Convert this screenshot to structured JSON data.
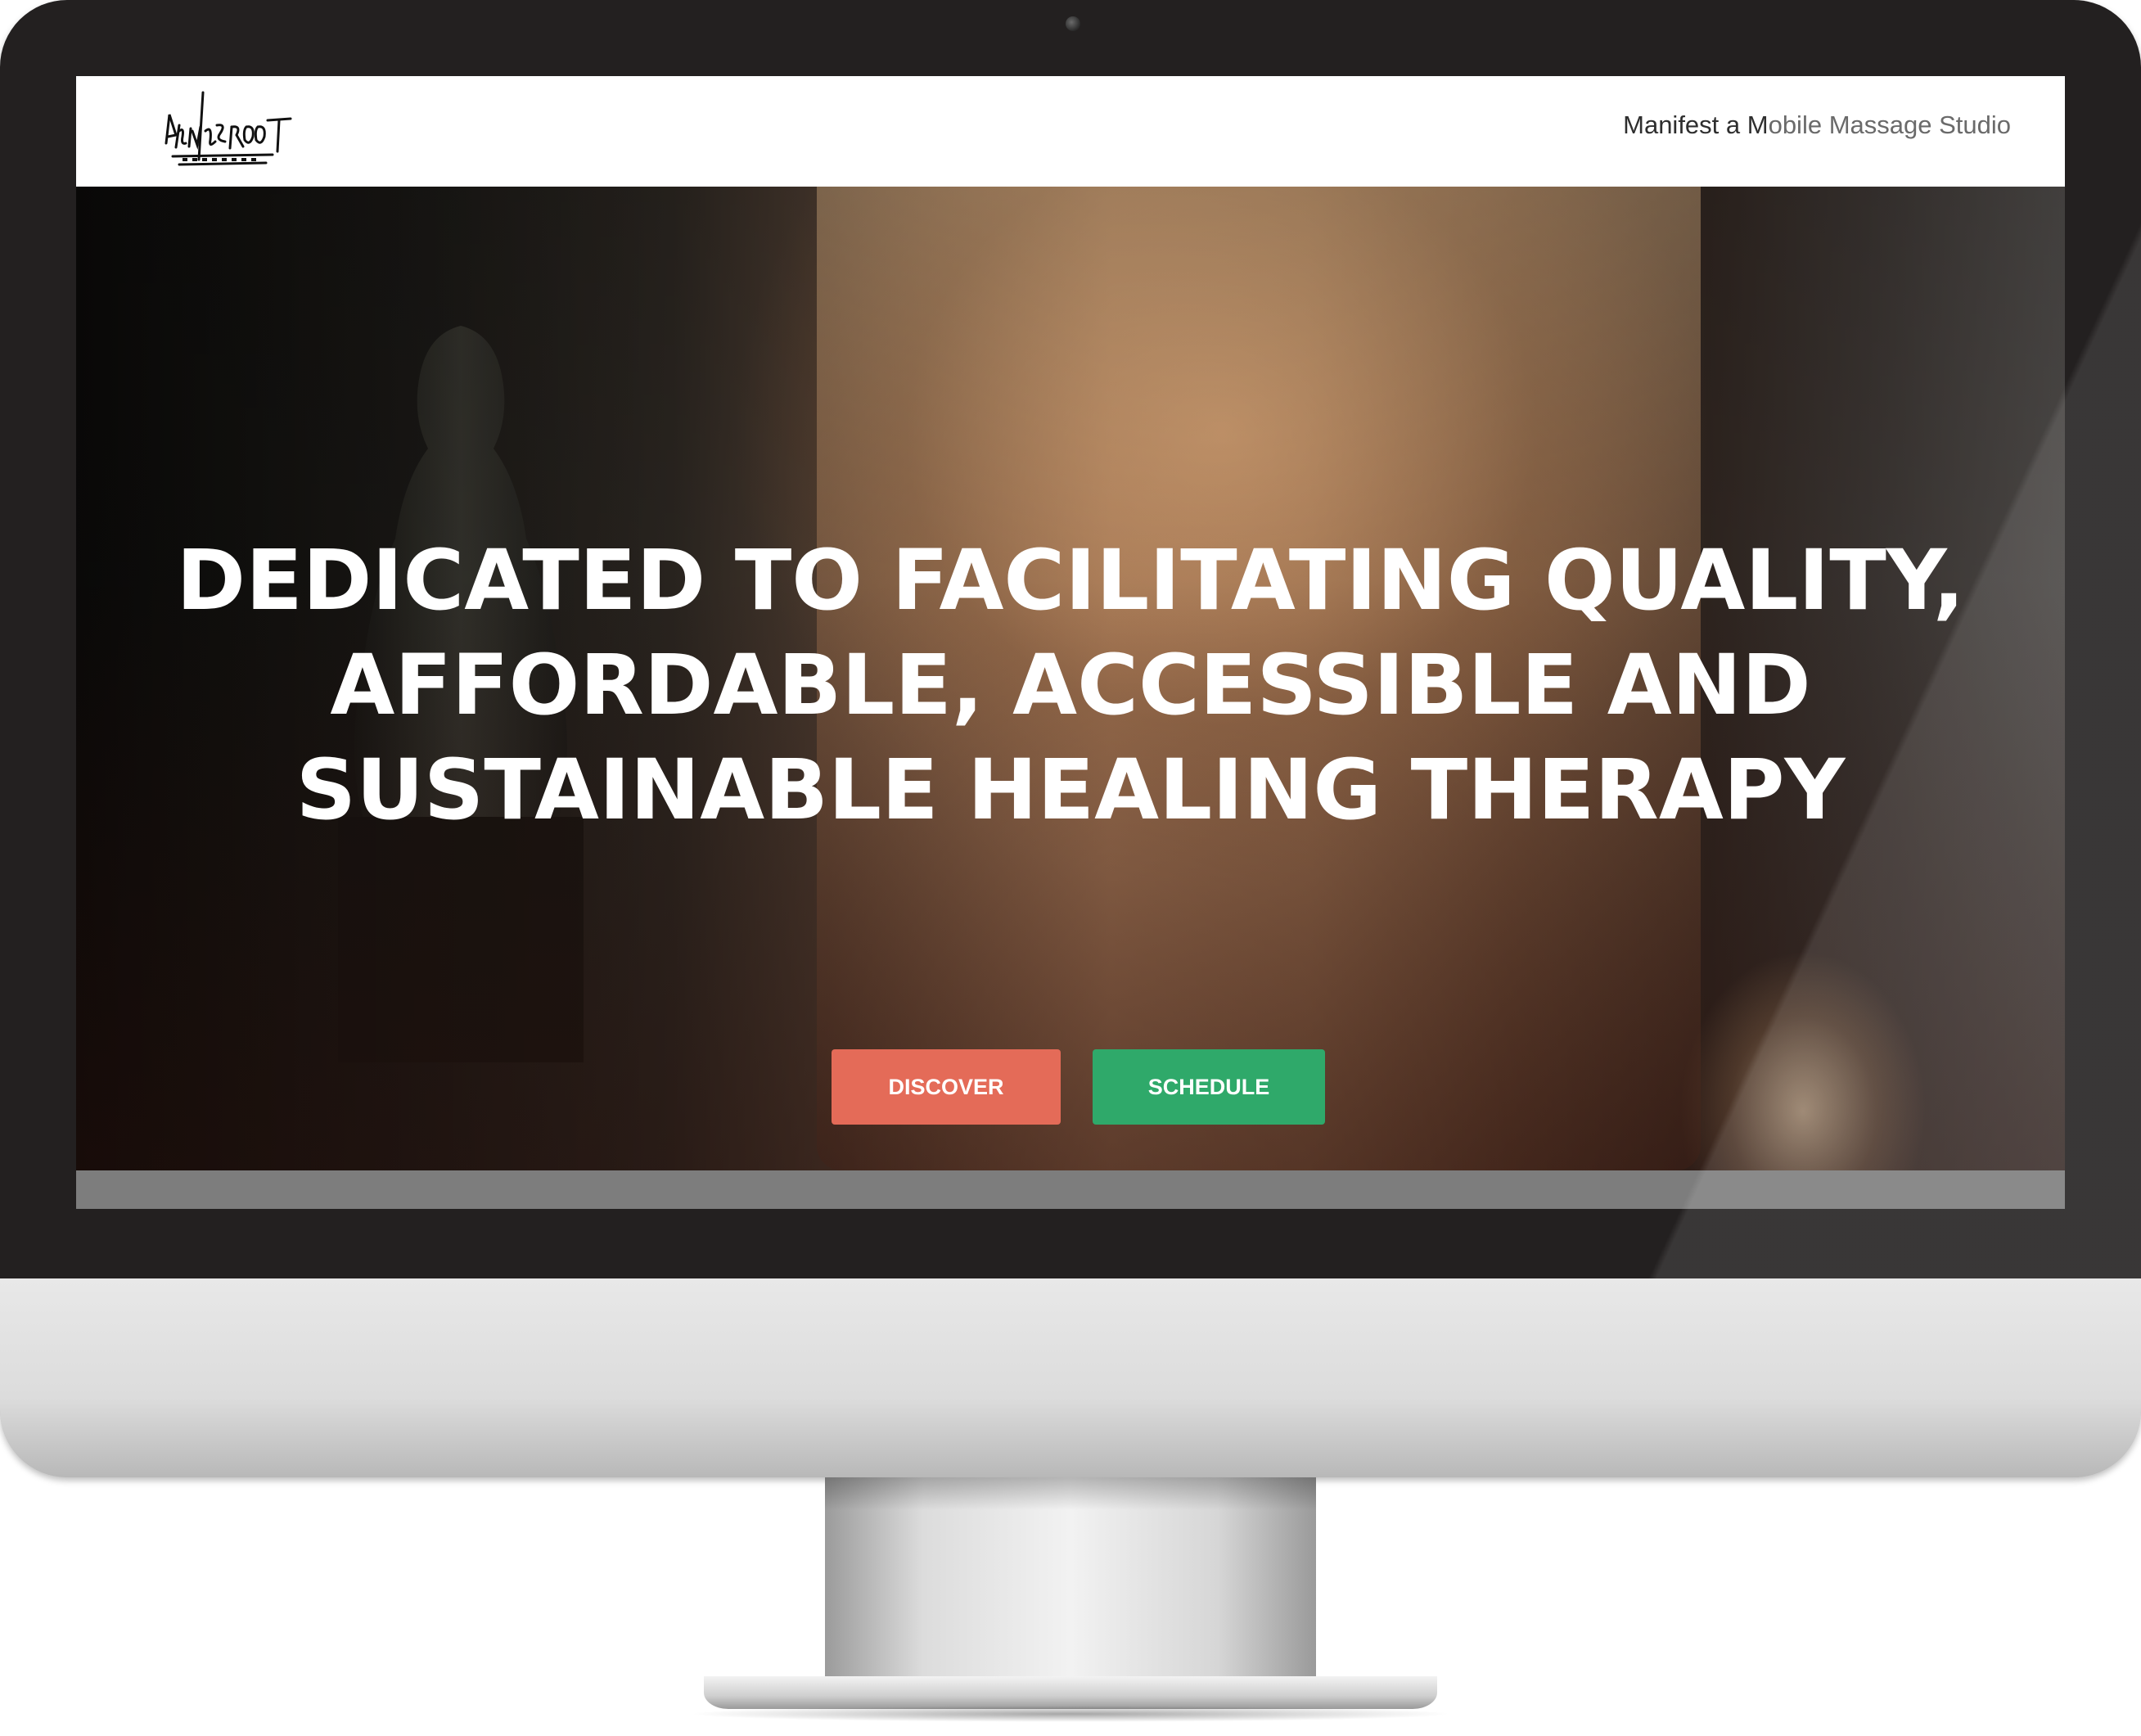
{
  "header": {
    "logo_alt": "Rhyming Root",
    "tagline_strong": "Manifest a M",
    "tagline_light": "obile Massage Studio"
  },
  "hero": {
    "headline_line1": "DEDICATED TO FACILITATING QUALITY,",
    "headline_line2": "AFFORDABLE, ACCESSIBLE AND",
    "headline_line3": "SUSTAINABLE HEALING THERAPY"
  },
  "buttons": {
    "discover": "DISCOVER",
    "schedule": "SCHEDULE"
  },
  "colors": {
    "discover": "#e46b58",
    "schedule": "#2fa96a",
    "header_bg": "#ffffff",
    "bezel": "#232020"
  },
  "icons": {
    "logo": "rhyming-root-logo-icon",
    "camera": "camera-icon"
  }
}
